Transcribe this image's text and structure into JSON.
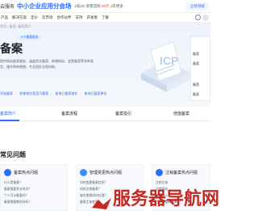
{
  "topnav": {
    "brand": "云服务",
    "promo_title": "中小企业应用分会场",
    "promo_text": "1核2G 新客首购",
    "promo_price": "99元",
    "promo_text_tail": "1年更多",
    "cta": "立即领取"
  },
  "subnav": {
    "items": [
      "产品",
      "解决方案",
      "定价",
      "云市场",
      "合作伙伴",
      "支持",
      "开发者",
      "了解"
    ]
  },
  "breadcrumb": "首页 / 备案 / 备案简介",
  "hero": {
    "badge": "ICP备案服务",
    "title": "备案",
    "desc": "提供网站备案服务，涵盖首次备案、新增网站、变更备案等多种类型，操作简单便捷，专业团队全程协助。",
    "links": [
      "开始备案",
      "检查域名是否可备案",
      "查询已备案域名",
      "查询已备案单位"
    ]
  },
  "icp_label": "ICP",
  "side_card": {
    "items": [
      "备案",
      "备案",
      "备案",
      "备案"
    ]
  },
  "tabs": [
    {
      "label": "备案简介",
      "active": true
    },
    {
      "label": "备案流程",
      "active": false
    },
    {
      "label": "备案指引",
      "active": false
    },
    {
      "label": "增值备案",
      "active": false
    }
  ],
  "section_title": "常见问题",
  "cards": [
    {
      "title": "备案热点问题",
      "items": [
        "什么是备案？",
        "备案需要多长时间？",
        "个人可以备案吗？",
        "备案需要哪些材料？"
      ]
    },
    {
      "title": "管理变更热点问题",
      "items": [
        "如何变更备案信息？",
        "如何注销备案？",
        "域名更换如何处理？",
        "备案主体变更"
      ]
    },
    {
      "title": "注销备案热点问题",
      "items": [
        "注销主体",
        "注销网站",
        "取消接入",
        "注销后重新备案"
      ]
    }
  ],
  "watermark": "服务器导航网",
  "colors": {
    "accent": "#2e6bff",
    "hero_bg": "#eef3fb",
    "watermark": "#c42a23"
  }
}
